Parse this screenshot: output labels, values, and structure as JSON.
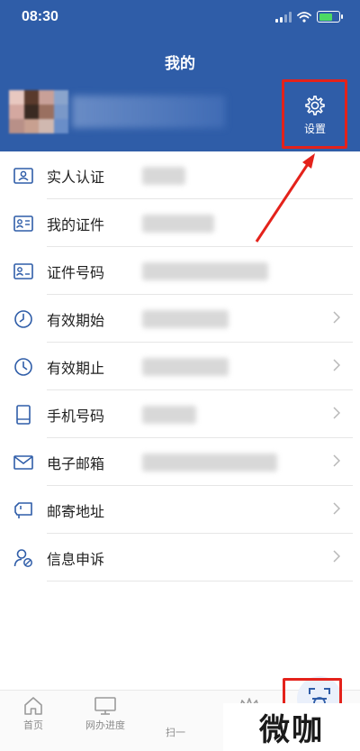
{
  "status_bar": {
    "time": "08:30"
  },
  "header": {
    "title": "我的",
    "settings_label": "设置"
  },
  "list": {
    "items": [
      {
        "label": "实人认证",
        "icon": "id-card-icon",
        "value_width": 48,
        "chevron": false
      },
      {
        "label": "我的证件",
        "icon": "certificate-icon",
        "value_width": 80,
        "chevron": false
      },
      {
        "label": "证件号码",
        "icon": "id-number-icon",
        "value_width": 140,
        "chevron": false
      },
      {
        "label": "有效期始",
        "icon": "clock-icon",
        "value_width": 96,
        "chevron": true
      },
      {
        "label": "有效期止",
        "icon": "clock-icon",
        "value_width": 96,
        "chevron": true
      },
      {
        "label": "手机号码",
        "icon": "phone-icon",
        "value_width": 60,
        "chevron": true
      },
      {
        "label": "电子邮箱",
        "icon": "mail-icon",
        "value_width": 150,
        "chevron": true
      },
      {
        "label": "邮寄地址",
        "icon": "mailbox-icon",
        "value_width": 0,
        "chevron": true
      },
      {
        "label": "信息申诉",
        "icon": "user-appeal-icon",
        "value_width": 0,
        "chevron": true
      }
    ]
  },
  "bottom_nav": {
    "home": "首页",
    "progress": "网办进度",
    "scan": "扫一"
  },
  "watermark": {
    "text_a": "微",
    "text_b": "咖"
  },
  "colors": {
    "header_bg": "#2f5da8",
    "accent": "#2f5da8",
    "highlight": "#e4221b"
  }
}
